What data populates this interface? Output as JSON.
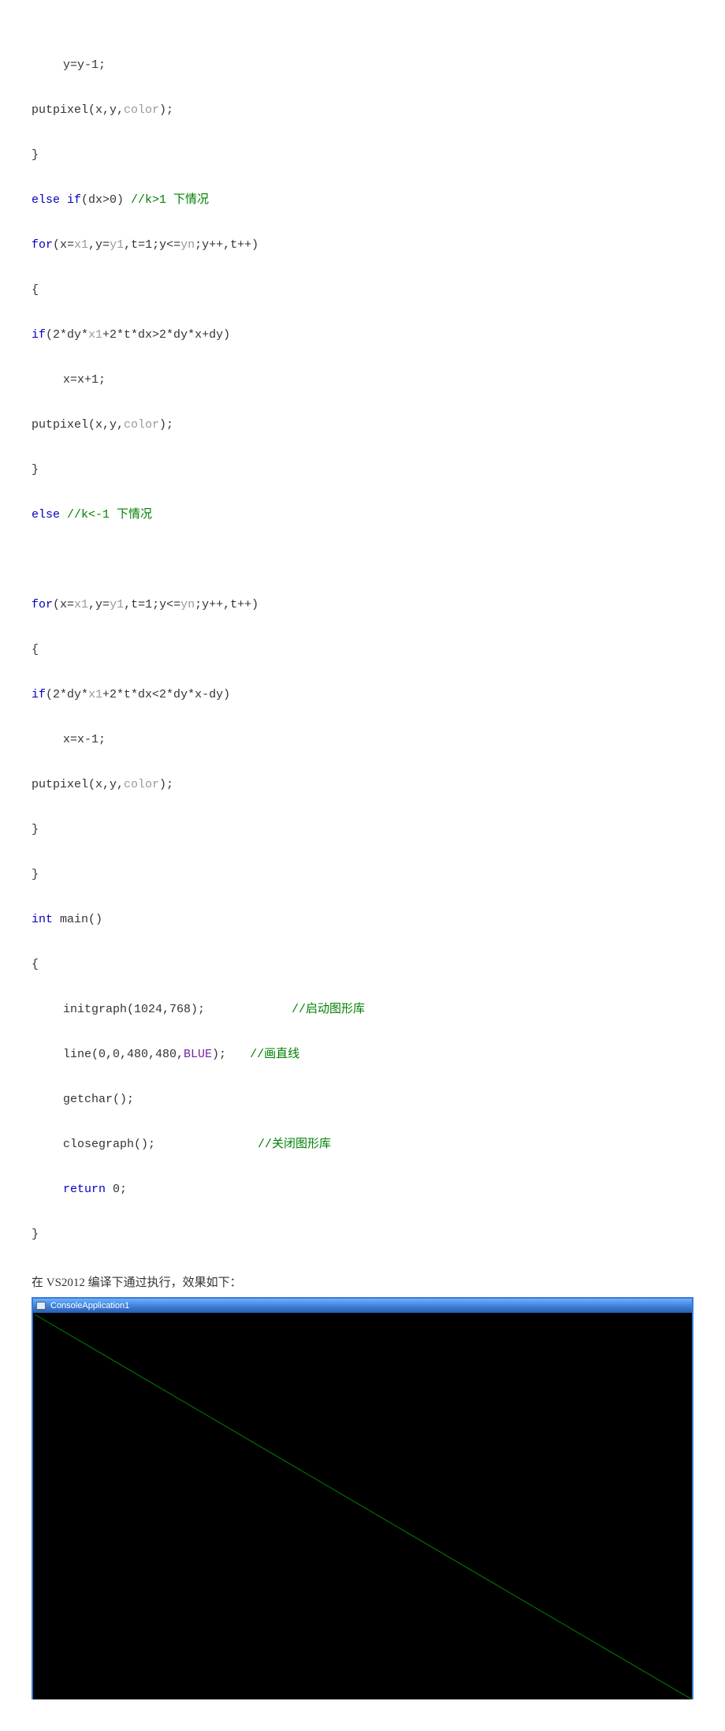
{
  "code": {
    "l01": "y=y-1;",
    "l02_a": "putpixel(x,y,",
    "l02_b": "color",
    "l02_c": ");",
    "l03": "}",
    "l04_else": "else ",
    "l04_if": "if",
    "l04_rest": "(dx>0) ",
    "l04_cmt": "//k>1 下情况",
    "l05_for": "for",
    "l05_a": "(x=",
    "l05_x1": "x1",
    "l05_b": ",y=",
    "l05_y1": "y1",
    "l05_c": ",t=1;y<=",
    "l05_yn": "yn",
    "l05_d": ";y++,t++)",
    "l06": "{",
    "l07_if": "if",
    "l07_a": "(2*dy*",
    "l07_x1": "x1",
    "l07_b": "+2*t*dx>2*dy*x+dy)",
    "l08": "x=x+1;",
    "l09_a": "putpixel(x,y,",
    "l09_b": "color",
    "l09_c": ");",
    "l10": "}",
    "l11_else": "else ",
    "l11_cmt": "//k<-1 下情况",
    "l12": "",
    "l13_for": "for",
    "l13_a": "(x=",
    "l13_x1": "x1",
    "l13_b": ",y=",
    "l13_y1": "y1",
    "l13_c": ",t=1;y<=",
    "l13_yn": "yn",
    "l13_d": ";y++,t++)",
    "l14": "{",
    "l15_if": "if",
    "l15_a": "(2*dy*",
    "l15_x1": "x1",
    "l15_b": "+2*t*dx<2*dy*x-dy)",
    "l16": "x=x-1;",
    "l17_a": "putpixel(x,y,",
    "l17_b": "color",
    "l17_c": ");",
    "l18": "}",
    "l19": "}",
    "l20_int": "int",
    "l20_b": " main()",
    "l21": "{",
    "l22_a": "initgraph(1024,768);",
    "l22_cmt": "//启动图形库",
    "l23_a": "line(0,0,480,480,",
    "l23_blue": "BLUE",
    "l23_b": ");",
    "l23_cmt": "//画直线",
    "l24": "getchar();",
    "l25_a": "closegraph();",
    "l25_cmt": "//关闭图形库",
    "l26_ret": "return",
    "l26_b": " 0;",
    "l27": "}"
  },
  "body_text": "在 VS2012 编译下通过执行，效果如下：",
  "console": {
    "title": "ConsoleApplication1",
    "line_color": "#007f00",
    "bg": "#000000"
  }
}
